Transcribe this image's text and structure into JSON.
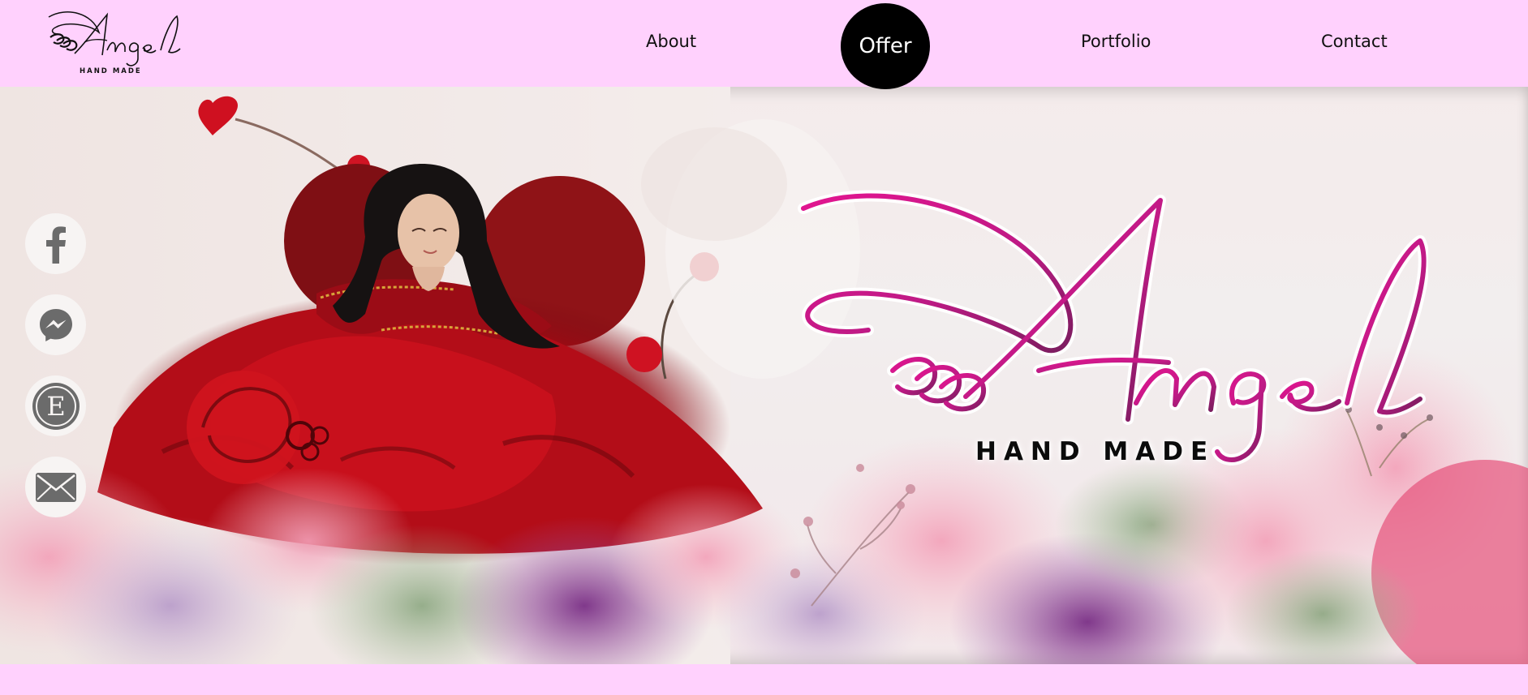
{
  "nav": {
    "items": [
      {
        "label": "About"
      },
      {
        "label": "Offer"
      },
      {
        "label": "Portfolio"
      },
      {
        "label": "Contact"
      }
    ],
    "active_index": 1
  },
  "brand": {
    "logo_text": "Angel",
    "logo_subtext": "HAND MADE",
    "tagline": "HAND MADE"
  },
  "social": [
    {
      "icon": "facebook-icon"
    },
    {
      "icon": "messenger-icon"
    },
    {
      "icon": "etsy-icon"
    },
    {
      "icon": "mail-icon"
    }
  ],
  "colors": {
    "page_background": "#ffd1fd",
    "active_nav_background": "#000000",
    "logo_magenta": "#d9168c",
    "logo_purple": "#8a1f6b",
    "social_icon_grey": "#6b6b6b"
  }
}
